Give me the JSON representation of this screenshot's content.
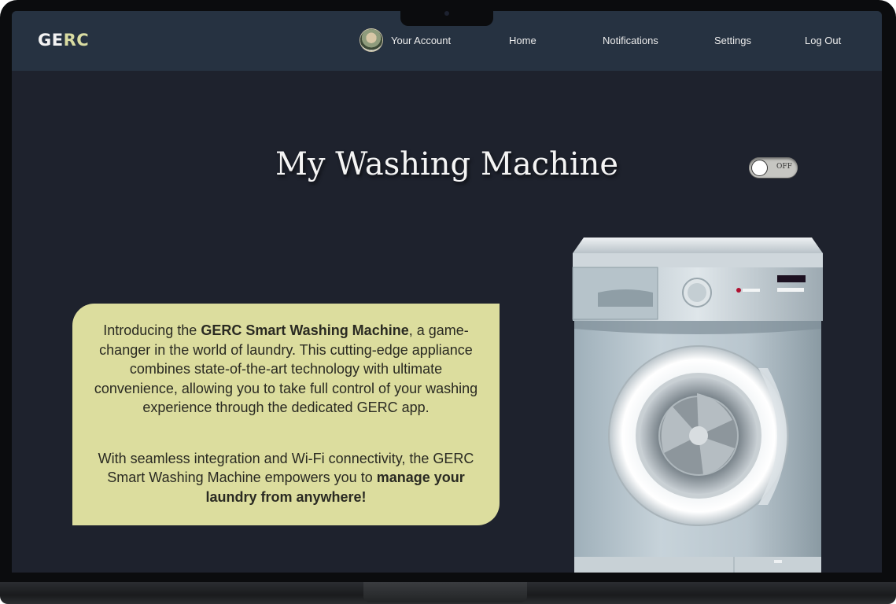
{
  "nav": {
    "logo_left": "GE",
    "logo_right": "RC",
    "account": "Your Account",
    "home": "Home",
    "notifications": "Notifications",
    "settings": "Settings",
    "logout": "Log Out"
  },
  "page": {
    "title": "My Washing Machine",
    "power_toggle": {
      "label": "OFF",
      "state": "off"
    }
  },
  "card": {
    "p1_a": "Introducing the ",
    "p1_b": "GERC Smart Washing Machine",
    "p1_c": ", a game-changer in the world of laundry. This cutting-edge appliance combines state-of-the-art technology with ultimate convenience, allowing you to take full control of your washing experience through the dedicated GERC app.",
    "p2_a": "With seamless integration and Wi-Fi connectivity, the GERC Smart Washing Machine empowers you to ",
    "p2_b": "manage your laundry from anywhere!"
  },
  "colors": {
    "background": "#1e222d",
    "navbar": "#263241",
    "accent": "#d9dca2",
    "card": "#dcdd9e"
  },
  "icons": {
    "avatar": "user-avatar",
    "appliance": "washing-machine-image"
  }
}
